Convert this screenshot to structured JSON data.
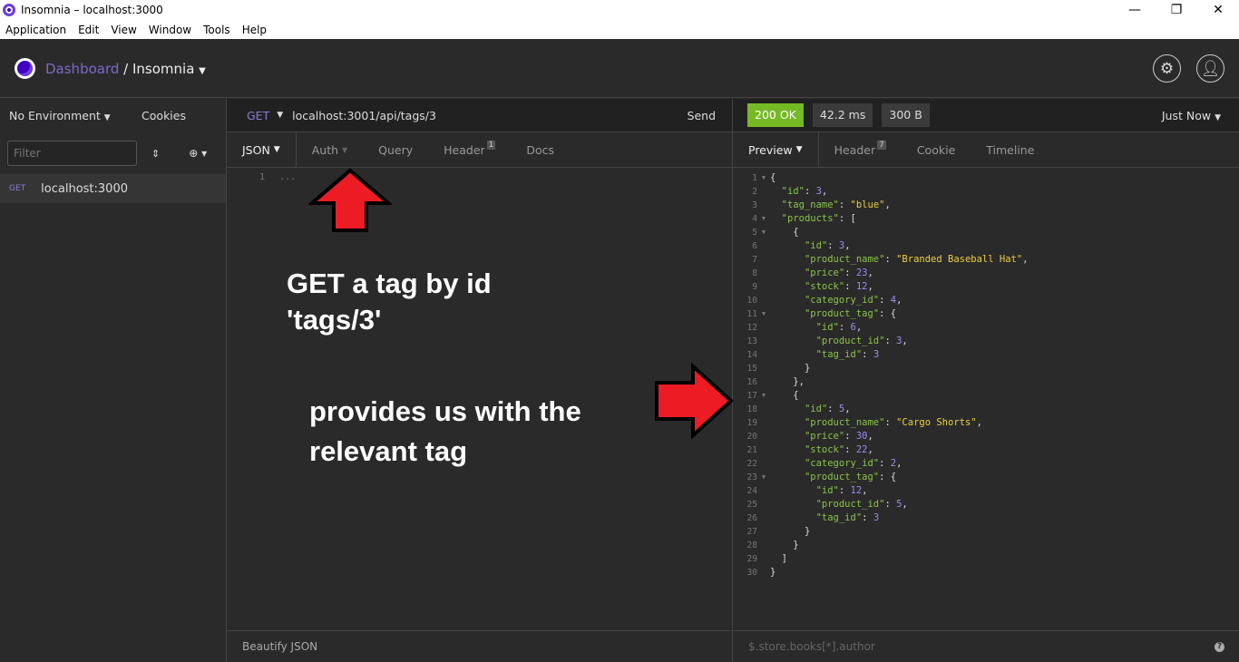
{
  "window": {
    "title": "Insomnia – localhost:3000",
    "controls": [
      "—",
      "❐",
      "✕"
    ]
  },
  "menu": [
    "Application",
    "Edit",
    "View",
    "Window",
    "Tools",
    "Help"
  ],
  "header": {
    "dashboard": "Dashboard",
    "separator": " / ",
    "workspace": "Insomnia"
  },
  "sidebar": {
    "environment": "No Environment",
    "cookies": "Cookies",
    "filter_placeholder": "Filter",
    "items": [
      {
        "method": "GET",
        "name": "localhost:3000"
      }
    ]
  },
  "request": {
    "method": "GET",
    "url": "localhost:3001/api/tags/3",
    "send": "Send",
    "tabs": [
      {
        "label": "JSON"
      },
      {
        "label": "Auth"
      },
      {
        "label": "Query"
      },
      {
        "label": "Header",
        "badge": "1"
      },
      {
        "label": "Docs"
      }
    ],
    "editor_line": "1",
    "editor_text": "...",
    "footer": "Beautify JSON"
  },
  "response": {
    "status": "200 OK",
    "time": "42.2 ms",
    "size": "300 B",
    "when": "Just Now",
    "tabs": [
      {
        "label": "Preview"
      },
      {
        "label": "Header",
        "badge": "7"
      },
      {
        "label": "Cookie"
      },
      {
        "label": "Timeline"
      }
    ],
    "filter_placeholder": "$.store.books[*].author",
    "help": "?",
    "lines": [
      [
        0,
        1,
        [
          [
            "p",
            "{"
          ]
        ]
      ],
      [
        1,
        0,
        [
          [
            "k",
            "\"id\""
          ],
          [
            "p",
            ": "
          ],
          [
            "n",
            "3"
          ],
          [
            "p",
            ","
          ]
        ]
      ],
      [
        1,
        0,
        [
          [
            "k",
            "\"tag_name\""
          ],
          [
            "p",
            ": "
          ],
          [
            "s",
            "\"blue\""
          ],
          [
            "p",
            ","
          ]
        ]
      ],
      [
        1,
        1,
        [
          [
            "k",
            "\"products\""
          ],
          [
            "p",
            ": ["
          ]
        ]
      ],
      [
        2,
        1,
        [
          [
            "p",
            "{"
          ]
        ]
      ],
      [
        3,
        0,
        [
          [
            "k",
            "\"id\""
          ],
          [
            "p",
            ": "
          ],
          [
            "n",
            "3"
          ],
          [
            "p",
            ","
          ]
        ]
      ],
      [
        3,
        0,
        [
          [
            "k",
            "\"product_name\""
          ],
          [
            "p",
            ": "
          ],
          [
            "s",
            "\"Branded Baseball Hat\""
          ],
          [
            "p",
            ","
          ]
        ]
      ],
      [
        3,
        0,
        [
          [
            "k",
            "\"price\""
          ],
          [
            "p",
            ": "
          ],
          [
            "n",
            "23"
          ],
          [
            "p",
            ","
          ]
        ]
      ],
      [
        3,
        0,
        [
          [
            "k",
            "\"stock\""
          ],
          [
            "p",
            ": "
          ],
          [
            "n",
            "12"
          ],
          [
            "p",
            ","
          ]
        ]
      ],
      [
        3,
        0,
        [
          [
            "k",
            "\"category_id\""
          ],
          [
            "p",
            ": "
          ],
          [
            "n",
            "4"
          ],
          [
            "p",
            ","
          ]
        ]
      ],
      [
        3,
        1,
        [
          [
            "k",
            "\"product_tag\""
          ],
          [
            "p",
            ": {"
          ]
        ]
      ],
      [
        4,
        0,
        [
          [
            "k",
            "\"id\""
          ],
          [
            "p",
            ": "
          ],
          [
            "n",
            "6"
          ],
          [
            "p",
            ","
          ]
        ]
      ],
      [
        4,
        0,
        [
          [
            "k",
            "\"product_id\""
          ],
          [
            "p",
            ": "
          ],
          [
            "n",
            "3"
          ],
          [
            "p",
            ","
          ]
        ]
      ],
      [
        4,
        0,
        [
          [
            "k",
            "\"tag_id\""
          ],
          [
            "p",
            ": "
          ],
          [
            "n",
            "3"
          ]
        ]
      ],
      [
        3,
        0,
        [
          [
            "p",
            "}"
          ]
        ]
      ],
      [
        2,
        0,
        [
          [
            "p",
            "},"
          ]
        ]
      ],
      [
        2,
        1,
        [
          [
            "p",
            "{"
          ]
        ]
      ],
      [
        3,
        0,
        [
          [
            "k",
            "\"id\""
          ],
          [
            "p",
            ": "
          ],
          [
            "n",
            "5"
          ],
          [
            "p",
            ","
          ]
        ]
      ],
      [
        3,
        0,
        [
          [
            "k",
            "\"product_name\""
          ],
          [
            "p",
            ": "
          ],
          [
            "s",
            "\"Cargo Shorts\""
          ],
          [
            "p",
            ","
          ]
        ]
      ],
      [
        3,
        0,
        [
          [
            "k",
            "\"price\""
          ],
          [
            "p",
            ": "
          ],
          [
            "n",
            "30"
          ],
          [
            "p",
            ","
          ]
        ]
      ],
      [
        3,
        0,
        [
          [
            "k",
            "\"stock\""
          ],
          [
            "p",
            ": "
          ],
          [
            "n",
            "22"
          ],
          [
            "p",
            ","
          ]
        ]
      ],
      [
        3,
        0,
        [
          [
            "k",
            "\"category_id\""
          ],
          [
            "p",
            ": "
          ],
          [
            "n",
            "2"
          ],
          [
            "p",
            ","
          ]
        ]
      ],
      [
        3,
        1,
        [
          [
            "k",
            "\"product_tag\""
          ],
          [
            "p",
            ": {"
          ]
        ]
      ],
      [
        4,
        0,
        [
          [
            "k",
            "\"id\""
          ],
          [
            "p",
            ": "
          ],
          [
            "n",
            "12"
          ],
          [
            "p",
            ","
          ]
        ]
      ],
      [
        4,
        0,
        [
          [
            "k",
            "\"product_id\""
          ],
          [
            "p",
            ": "
          ],
          [
            "n",
            "5"
          ],
          [
            "p",
            ","
          ]
        ]
      ],
      [
        4,
        0,
        [
          [
            "k",
            "\"tag_id\""
          ],
          [
            "p",
            ": "
          ],
          [
            "n",
            "3"
          ]
        ]
      ],
      [
        3,
        0,
        [
          [
            "p",
            "}"
          ]
        ]
      ],
      [
        2,
        0,
        [
          [
            "p",
            "}"
          ]
        ]
      ],
      [
        1,
        0,
        [
          [
            "p",
            "]"
          ]
        ]
      ],
      [
        0,
        0,
        [
          [
            "p",
            "}"
          ]
        ]
      ]
    ]
  },
  "annotations": {
    "line1": "GET a tag by id",
    "line2": "'tags/3'",
    "line3": "provides us with the",
    "line4": "relevant tag"
  }
}
